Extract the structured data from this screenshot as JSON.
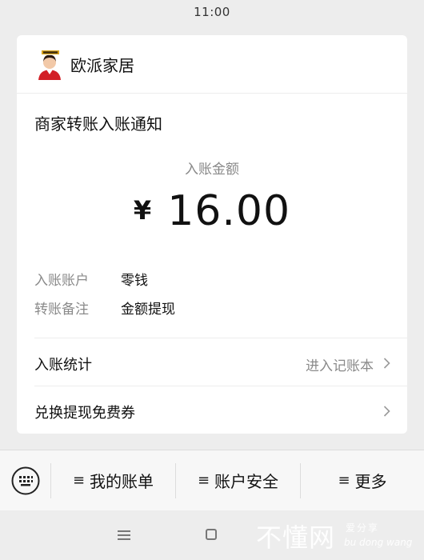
{
  "status_bar": {
    "time": "11:00"
  },
  "merchant": {
    "name": "欧派家居"
  },
  "notification": {
    "title": "商家转账入账通知",
    "amount_label": "入账金额",
    "currency_symbol": "¥",
    "amount": "16.00",
    "details": [
      {
        "label": "入账账户",
        "value": "零钱"
      },
      {
        "label": "转账备注",
        "value": "金额提现"
      }
    ],
    "stats_row": {
      "label": "入账统计",
      "link": "进入记账本"
    },
    "voucher_row": {
      "label": "兑换提现免费券"
    }
  },
  "bottom_menu": {
    "items": [
      {
        "label": "我的账单"
      },
      {
        "label": "账户安全"
      },
      {
        "label": "更多"
      }
    ]
  },
  "watermark": {
    "big": "不懂网",
    "small_cn": "爱分享",
    "small_py": "bu dong wang"
  },
  "icons": {
    "keyboard": "keyboard-icon",
    "chevron": "chevron-right-icon",
    "menu_hamburger": "hamburger-icon",
    "nav_menu": "nav-menu-icon",
    "nav_home": "nav-home-icon"
  },
  "colors": {
    "background": "#ededed",
    "card": "#ffffff",
    "secondary_text": "#888888"
  }
}
